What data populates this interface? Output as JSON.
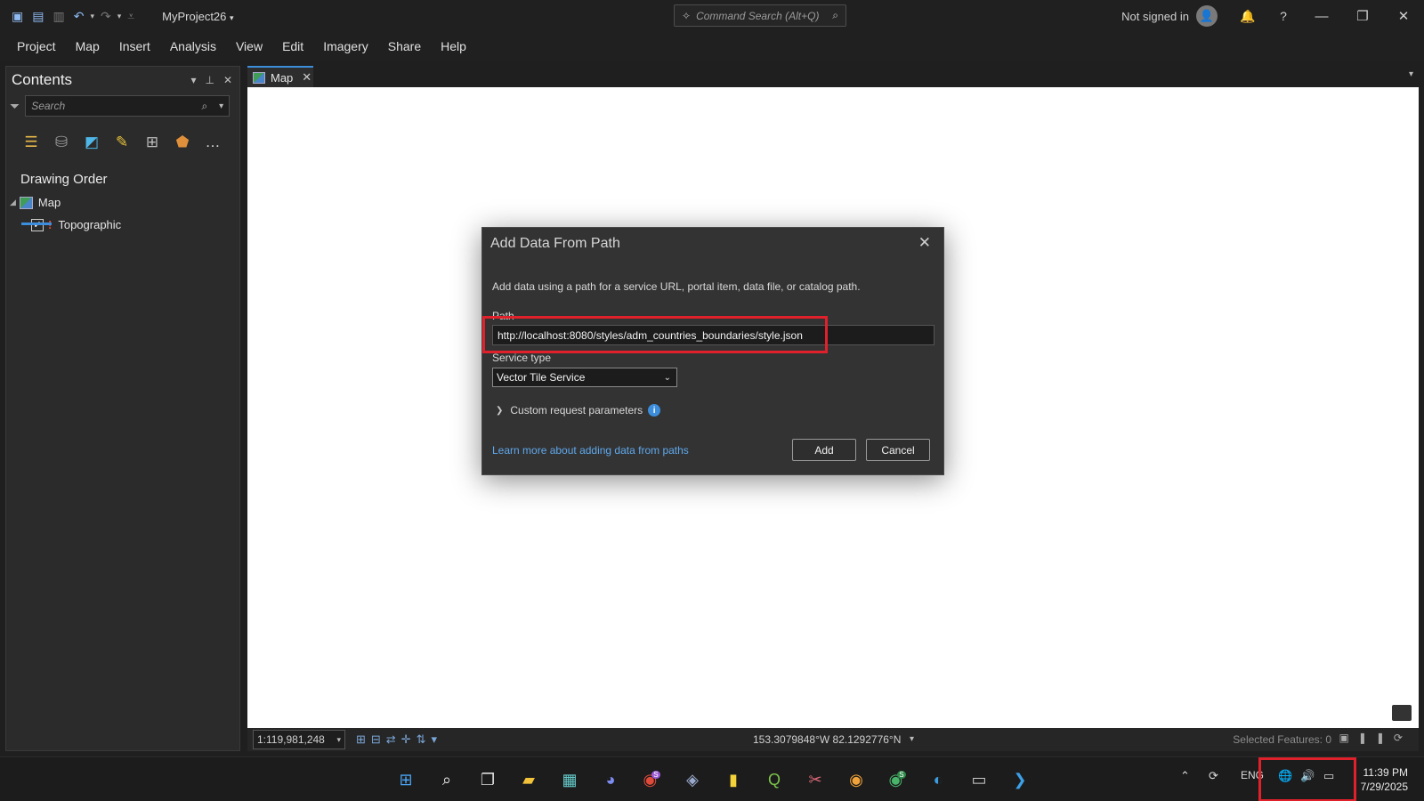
{
  "app": {
    "project_name": "MyProject26",
    "command_search_placeholder": "Command Search (Alt+Q)",
    "sign_in_status": "Not signed in"
  },
  "ribbon": {
    "tabs": [
      {
        "label": "Project"
      },
      {
        "label": "Map"
      },
      {
        "label": "Insert"
      },
      {
        "label": "Analysis"
      },
      {
        "label": "View"
      },
      {
        "label": "Edit"
      },
      {
        "label": "Imagery"
      },
      {
        "label": "Share"
      },
      {
        "label": "Help"
      }
    ]
  },
  "contents": {
    "title": "Contents",
    "search_placeholder": "Search",
    "section_title": "Drawing Order",
    "map_item": "Map",
    "layer": "Topographic",
    "tool_icons": [
      "list-by-drawing-order-icon",
      "list-by-source-icon",
      "list-by-selection-icon",
      "list-by-editing-icon",
      "list-by-snapping-icon",
      "list-by-labeling-icon",
      "more-icon"
    ]
  },
  "map_tab": {
    "label": "Map"
  },
  "status_bar": {
    "scale": "1:119,981,248",
    "coordinates": "153.3079848°W 82.1292776°N",
    "selected_features": "Selected Features: 0"
  },
  "dialog": {
    "title": "Add Data From Path",
    "description": "Add data using a path for a service URL, portal item, data file, or catalog path.",
    "path_label": "Path",
    "path_value": "http://localhost:8080/styles/adm_countries_boundaries/style.json",
    "service_type_label": "Service type",
    "service_type_value": "Vector Tile Service",
    "custom_params_label": "Custom request parameters",
    "learn_more_link": "Learn more about adding data from paths",
    "add_button": "Add",
    "cancel_button": "Cancel"
  },
  "taskbar": {
    "language": "ENG",
    "time": "11:39 PM",
    "date": "7/29/2025",
    "badge_chrome_1": "S",
    "badge_chrome_2": "S"
  },
  "colors": {
    "accent": "#3c8ddb",
    "highlight_box": "#e0202a",
    "link": "#5fa8ec"
  }
}
